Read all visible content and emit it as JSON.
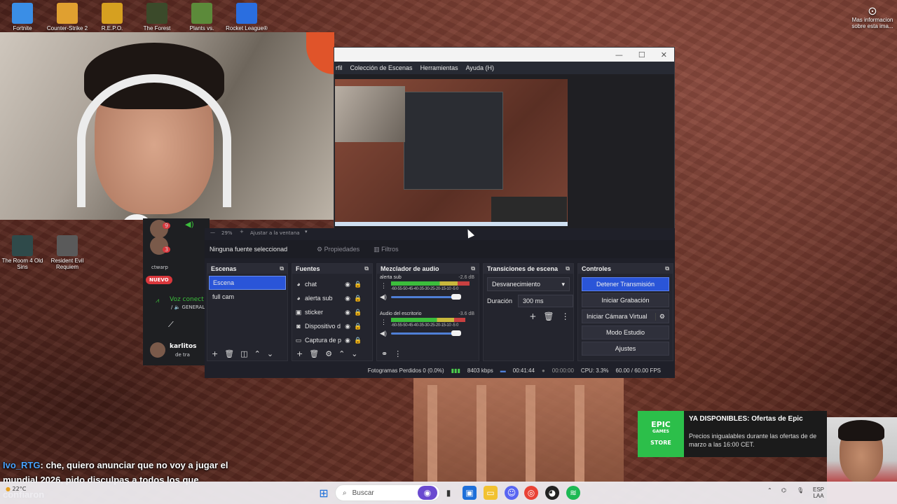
{
  "desktop": {
    "top_icons": [
      {
        "label": "Fortnite",
        "icon": "fortnite-icon",
        "color": "#3a8ee6"
      },
      {
        "label": "Counter-Strike 2",
        "icon": "counter-strike-icon",
        "color": "#e0a030"
      },
      {
        "label": "R.E.P.O.",
        "icon": "repo-icon",
        "color": "#d6a020"
      },
      {
        "label": "The Forest",
        "icon": "the-forest-icon",
        "color": "#3b4a2a"
      },
      {
        "label": "Plants vs.",
        "icon": "plants-vs-zombies-icon",
        "color": "#5c8a3a"
      },
      {
        "label": "Rocket League®",
        "icon": "rocket-league-icon",
        "color": "#2a6ee0"
      }
    ],
    "side_icons": [
      {
        "label": "The Room 4 Old Sins",
        "icon": "the-room-icon",
        "color": "#2f4a4a"
      },
      {
        "label": "Resident Evil Requiem",
        "icon": "resident-evil-icon",
        "color": "#5a5a5a"
      }
    ],
    "notice": "Mas informacion sobre esta ima..."
  },
  "discord": {
    "badges": [
      "9",
      "3"
    ],
    "tag": "ctwarp",
    "new_label": "NUEVO",
    "voice_label": "Voz conect",
    "voice_sub": "/ 🔈 GENERAL",
    "user": "karlitos",
    "user_sub": "de tra"
  },
  "obs": {
    "menu": [
      "rfil",
      "Colección de Escenas",
      "Herramientas",
      "Ayuda (H)"
    ],
    "zoom": "29%",
    "fit_label": "Ajustar a la ventana",
    "no_source": "Ninguna fuente seleccionad",
    "properties_label": "Propiedades",
    "filters_label": "Filtros",
    "scenes": {
      "title": "Escenas",
      "items": [
        {
          "label": "Escena",
          "selected": true
        },
        {
          "label": "full cam",
          "selected": false
        }
      ]
    },
    "sources": {
      "title": "Fuentes",
      "items": [
        {
          "label": "chat",
          "icon": "browser-icon"
        },
        {
          "label": "alerta sub",
          "icon": "browser-icon"
        },
        {
          "label": "sticker",
          "icon": "image-icon"
        },
        {
          "label": "Dispositivo d",
          "icon": "camera-icon"
        },
        {
          "label": "Captura de p",
          "icon": "monitor-icon"
        }
      ]
    },
    "mixer": {
      "title": "Mezclador de audio",
      "channels": [
        {
          "label": "alerta sub",
          "db": "-2.6 dB",
          "level": 0.78
        },
        {
          "label": "Audio del escritorio",
          "db": "-3.6 dB",
          "level": 0.74
        }
      ],
      "scale": "-60-55-50-45-40-35-30-25-20-15-10 -5 0"
    },
    "transitions": {
      "title": "Transiciones de escena",
      "type": "Desvanecimiento",
      "duration_label": "Duración",
      "duration": "300 ms"
    },
    "controls": {
      "title": "Controles",
      "buttons": [
        {
          "label": "Detener Transmisión",
          "active": true
        },
        {
          "label": "Iniciar Grabación",
          "active": false
        },
        {
          "label": "Iniciar Cámara Virtual",
          "active": false
        },
        {
          "label": "Modo Estudio",
          "active": false
        },
        {
          "label": "Ajustes",
          "active": false
        }
      ]
    },
    "status": {
      "dropped": "Fotogramas Perdidos 0 (0.0%)",
      "bitrate": "8403 kbps",
      "live_time": "00:41:44",
      "rec_time": "00:00:00",
      "cpu": "CPU: 3.3%",
      "fps": "60.00 / 60.00 FPS"
    }
  },
  "chat": {
    "user": "Ivo_RTG",
    "message": ": che, quiero anunciar que no voy a jugar el mundial 2026, pido disculpas a todos los que confiaron"
  },
  "epic": {
    "logo_top": "EPIC",
    "logo_mid": "GAMES",
    "logo_bottom": "STORE",
    "title": "YA DISPONIBLES: Ofertas de Epic",
    "message": "Precios inigualables durante las ofertas de de marzo a las 16:00 CET."
  },
  "taskbar": {
    "weather": "22°C",
    "search_placeholder": "Buscar",
    "lang": "ESP",
    "lang_sub": "LAA"
  }
}
